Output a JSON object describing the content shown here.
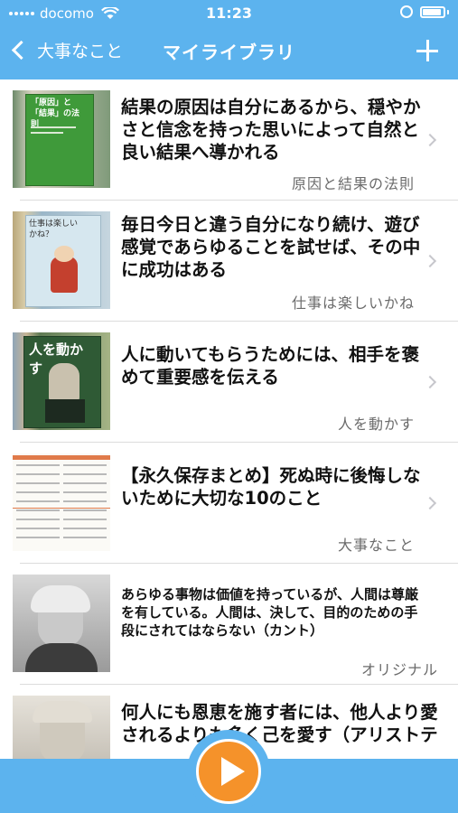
{
  "status_bar": {
    "carrier": "docomo",
    "time": "11:23"
  },
  "nav": {
    "back_label": "大事なこと",
    "title": "マイライブラリ"
  },
  "items": [
    {
      "quote": "結果の原因は自分にあるから、穏やかさと信念を持った思いによって自然と良い結果へ導かれる",
      "source": "原因と結果の法則",
      "cover_text": "「原因」と「結果」の法則"
    },
    {
      "quote": "毎日今日と違う自分になり続け、遊び感覚であらゆることを試せば、その中に成功はある",
      "source": "仕事は楽しいかね",
      "cover_text": "仕事は楽しいかね？"
    },
    {
      "quote": "人に動いてもらうためには、相手を褒めて重要感を伝える",
      "source": "人を動かす",
      "cover_text": "人を動かす"
    },
    {
      "quote": "【永久保存まとめ】死ぬ時に後悔しないために大切な10のこと",
      "source": "大事なこと"
    },
    {
      "quote": "あらゆる事物は価値を持っているが、人間は尊厳を有している。人間は、決して、目的のための手段にされてはならない（カント）",
      "source": "オリジナル"
    },
    {
      "quote": "何人にも恩恵を施す者には、他人より愛されるよりも多く己を愛す（アリストテ",
      "source": ""
    }
  ],
  "colors": {
    "header": "#5cb3ee",
    "play": "#f5922a"
  }
}
